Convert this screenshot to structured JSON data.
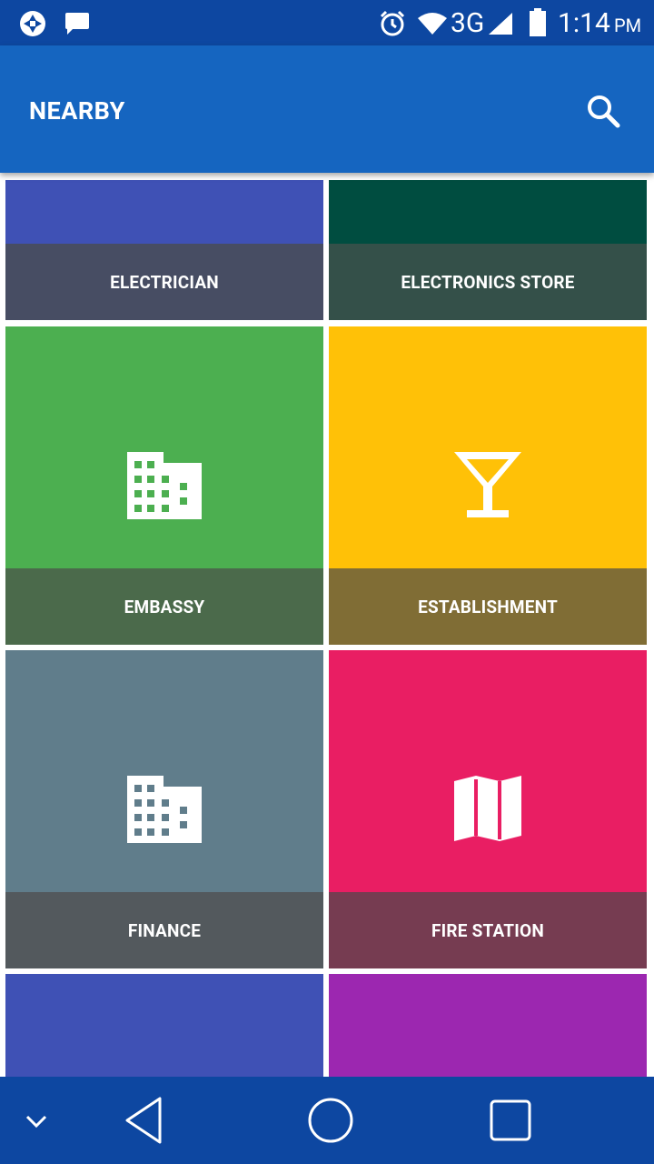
{
  "status_bar": {
    "network": "3G",
    "time": "1:14",
    "ampm": "PM",
    "icons": [
      "camera-shutter-icon",
      "message-icon",
      "alarm-icon",
      "wifi-icon",
      "cell-signal-icon",
      "battery-icon"
    ]
  },
  "app_bar": {
    "title": "NEARBY",
    "search_icon": "search-icon"
  },
  "tiles": [
    {
      "label": "ELECTRICIAN",
      "icon": "map-icon",
      "top_color": "#3F51B5",
      "bottom_color": "#474D63"
    },
    {
      "label": "ELECTRONICS STORE",
      "icon": "map-icon",
      "top_color": "#004D40",
      "bottom_color": "#345049"
    },
    {
      "label": "EMBASSY",
      "icon": "building-icon",
      "top_color": "#4CAF50",
      "bottom_color": "#4B6A4B"
    },
    {
      "label": "ESTABLISHMENT",
      "icon": "cocktail-icon",
      "top_color": "#FFC107",
      "bottom_color": "#806D35"
    },
    {
      "label": "FINANCE",
      "icon": "building-icon",
      "top_color": "#607D8B",
      "bottom_color": "#53595D"
    },
    {
      "label": "FIRE STATION",
      "icon": "map-icon",
      "top_color": "#E91E63",
      "bottom_color": "#763C51"
    },
    {
      "label": "",
      "icon": "",
      "top_color": "#3F51B5",
      "bottom_color": "#474D63"
    },
    {
      "label": "",
      "icon": "",
      "top_color": "#9C27B0",
      "bottom_color": "#5E3A69"
    }
  ],
  "nav_bar": {
    "buttons": [
      "collapse-icon",
      "back-icon",
      "home-icon",
      "recents-icon"
    ]
  }
}
